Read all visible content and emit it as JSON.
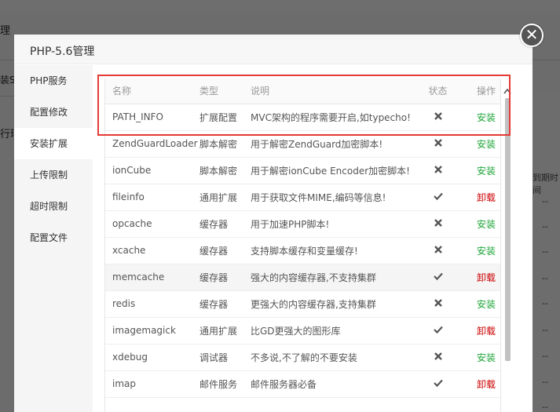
{
  "background": {
    "title_fragment": "理",
    "text_fragment_1": "装SC",
    "text_fragment_2": "行环",
    "text_fragment_3": "到期时间",
    "dashes": [
      "--",
      "--",
      "--",
      "--",
      "--",
      "--",
      "--",
      "--",
      "--"
    ]
  },
  "modal": {
    "title": "PHP-5.6管理",
    "close_glyph": "✕"
  },
  "sidebar": {
    "items": [
      {
        "label": "PHP服务",
        "active": false
      },
      {
        "label": "配置修改",
        "active": false
      },
      {
        "label": "安装扩展",
        "active": true
      },
      {
        "label": "上传限制",
        "active": false
      },
      {
        "label": "超时限制",
        "active": false
      },
      {
        "label": "配置文件",
        "active": false
      }
    ]
  },
  "table": {
    "headers": [
      "名称",
      "类型",
      "说明",
      "状态",
      "操作"
    ],
    "rows": [
      {
        "name": "PATH_INFO",
        "type": "扩展配置",
        "desc": "MVC架构的程序需要开启,如typecho!",
        "installed": false,
        "action": "安装"
      },
      {
        "name": "ZendGuardLoader",
        "type": "脚本解密",
        "desc": "用于解密ZendGuard加密脚本!",
        "installed": false,
        "action": "安装"
      },
      {
        "name": "ionCube",
        "type": "脚本解密",
        "desc": "用于解密ionCube Encoder加密脚本!",
        "installed": false,
        "action": "安装"
      },
      {
        "name": "fileinfo",
        "type": "通用扩展",
        "desc": "用于获取文件MIME,编码等信息!",
        "installed": true,
        "action": "卸载"
      },
      {
        "name": "opcache",
        "type": "缓存器",
        "desc": "用于加速PHP脚本!",
        "installed": false,
        "action": "安装"
      },
      {
        "name": "xcache",
        "type": "缓存器",
        "desc": "支持脚本缓存和变量缓存!",
        "installed": false,
        "action": "安装"
      },
      {
        "name": "memcache",
        "type": "缓存器",
        "desc": "强大的内容缓存器,不支持集群",
        "installed": true,
        "action": "卸载"
      },
      {
        "name": "redis",
        "type": "缓存器",
        "desc": "更强大的内容缓存器,支持集群",
        "installed": false,
        "action": "安装"
      },
      {
        "name": "imagemagick",
        "type": "通用扩展",
        "desc": "比GD更强大的图形库",
        "installed": true,
        "action": "卸载"
      },
      {
        "name": "xdebug",
        "type": "调试器",
        "desc": "不多说,不了解的不要安装",
        "installed": false,
        "action": "安装"
      },
      {
        "name": "imap",
        "type": "邮件服务",
        "desc": "邮件服务器必备",
        "installed": true,
        "action": "卸载"
      }
    ],
    "highlighted_row": 6
  },
  "icons": {
    "status_installed": "check-icon",
    "status_not_installed": "cross-icon",
    "scroll_up": "chevron-up-icon",
    "scroll_down": "chevron-down-icon"
  },
  "colors": {
    "install": "#20a53a",
    "uninstall": "#cc0000",
    "annotation_box": "#e53935"
  }
}
